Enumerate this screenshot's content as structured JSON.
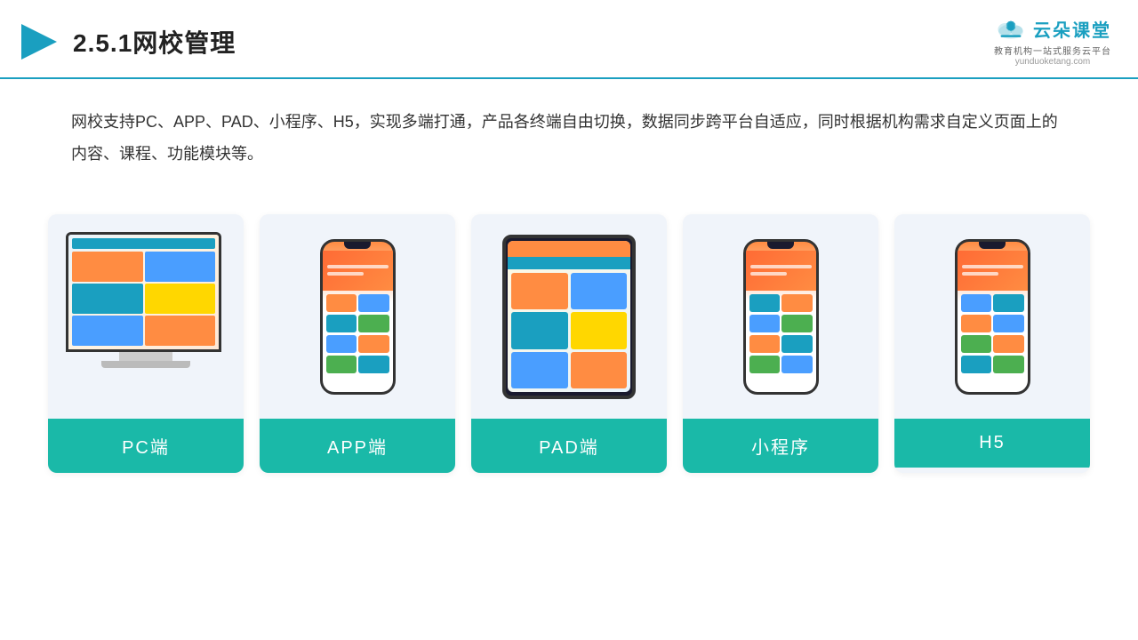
{
  "header": {
    "title": "2.5.1网校管理",
    "logo": {
      "name": "云朵课堂",
      "url": "yunduoketang.com",
      "tagline": "教育机构一站\n式服务云平台"
    }
  },
  "description": {
    "text": "网校支持PC、APP、PAD、小程序、H5，实现多端打通，产品各终端自由切换，数据同步跨平台自适应，同时根据机构需求自定义页面上的内容、课程、功能模块等。"
  },
  "cards": [
    {
      "id": "pc",
      "label": "PC端",
      "type": "pc"
    },
    {
      "id": "app",
      "label": "APP端",
      "type": "phone"
    },
    {
      "id": "pad",
      "label": "PAD端",
      "type": "tablet"
    },
    {
      "id": "miniapp",
      "label": "小程序",
      "type": "phone"
    },
    {
      "id": "h5",
      "label": "H5",
      "type": "phone"
    }
  ],
  "colors": {
    "accent": "#1ab9a8",
    "header_border": "#1a9fc0",
    "card_bg": "#f0f4fa"
  }
}
